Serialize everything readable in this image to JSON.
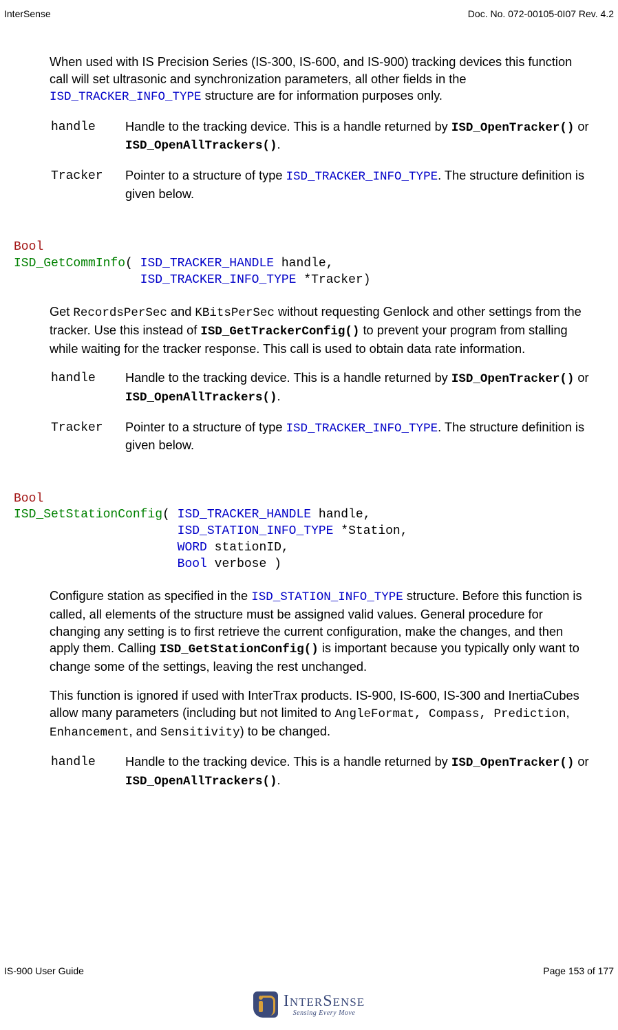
{
  "header": {
    "left": "InterSense",
    "right": "Doc. No. 072-00105-0I07 Rev. 4.2"
  },
  "s1": {
    "para1_a": "When used with IS Precision Series (IS-300, IS-600, and IS-900) tracking devices this function call will set ultrasonic and synchronization parameters, all other fields in the ",
    "token1": "ISD_TRACKER_INFO_TYPE",
    "para1_b": " structure are for information purposes only.",
    "p_handle": "handle",
    "p_handle_a": "Handle to the tracking device.  This is a handle returned by ",
    "p_handle_b": "ISD_OpenTracker()",
    "p_handle_c": " or ",
    "p_handle_d": "ISD_OpenAllTrackers()",
    "p_handle_e": ".",
    "p_tracker": "Tracker",
    "p_tracker_a": "Pointer to a structure of type ",
    "p_tracker_b": "ISD_TRACKER_INFO_TYPE",
    "p_tracker_c": ".  The structure definition is given below."
  },
  "sig2": {
    "ret": "Bool",
    "name": "ISD_GetCommInfo",
    "l1a": "( ",
    "l1t": "ISD_TRACKER_HANDLE",
    "l1b": " handle,",
    "pad": "                 ",
    "l2t": "ISD_TRACKER_INFO_TYPE",
    "l2b": " *Tracker)"
  },
  "s2": {
    "para1_a": "Get ",
    "tok_rps": "RecordsPerSec",
    "para1_b": " and ",
    "tok_kbs": "KBitsPerSec",
    "para1_c": " without requesting Genlock and other settings from the tracker. Use this instead of ",
    "tok_gtc": "ISD_GetTrackerConfig()",
    "para1_d": " to prevent your program from stalling while waiting for the tracker response. This call is used to obtain data rate information.",
    "p_handle": "handle",
    "p_handle_a": "Handle to the tracking device.  This is a handle returned by ",
    "p_handle_b": "ISD_OpenTracker()",
    "p_handle_c": " or ",
    "p_handle_d": "ISD_OpenAllTrackers()",
    "p_handle_e": ".",
    "p_tracker": "Tracker",
    "p_tracker_a": "Pointer to a structure of type ",
    "p_tracker_b": "ISD_TRACKER_INFO_TYPE",
    "p_tracker_c": ".  The structure definition is given below."
  },
  "sig3": {
    "ret": "Bool",
    "name": "ISD_SetStationConfig",
    "l1a": "( ",
    "l1t": "ISD_TRACKER_HANDLE",
    "l1b": " handle,",
    "pad": "                      ",
    "l2t": "ISD_STATION_INFO_TYPE",
    "l2b": " *Station,",
    "l3t": "WORD",
    "l3b": " stationID,",
    "l4t": "Bool",
    "l4b": " verbose )"
  },
  "s3": {
    "para1_a": "Configure station as specified in the ",
    "tok1": "ISD_STATION_INFO_TYPE",
    "para1_b": " structure. Before this function is called, all elements of the structure must be assigned valid values. General procedure for changing any setting is to first retrieve the current configuration, make the changes, and then apply them.  Calling ",
    "tok2": "ISD_GetStationConfig()",
    "para1_c": " is important because you typically only want to change some of the settings, leaving the rest unchanged.",
    "para2_a": "This function is ignored if used with InterTrax products.  IS-900, IS-600, IS-300 and InertiaCubes allow many parameters (including but not limited to ",
    "tok3": "AngleFormat, Compass, Prediction",
    "para2_b": ", ",
    "tok4": "Enhancement",
    "para2_c": ", and ",
    "tok5": "Sensitivity",
    "para2_d": ") to be changed.",
    "p_handle": "handle",
    "p_handle_a": "Handle to the tracking device.  This is a handle returned by ",
    "p_handle_b": "ISD_OpenTracker()",
    "p_handle_c": " or ",
    "p_handle_d": "ISD_OpenAllTrackers()",
    "p_handle_e": "."
  },
  "footer": {
    "left": "IS-900 User Guide",
    "right": "Page 153 of 177"
  },
  "logo": {
    "name": "InterSense",
    "tagline": "Sensing Every Move"
  }
}
